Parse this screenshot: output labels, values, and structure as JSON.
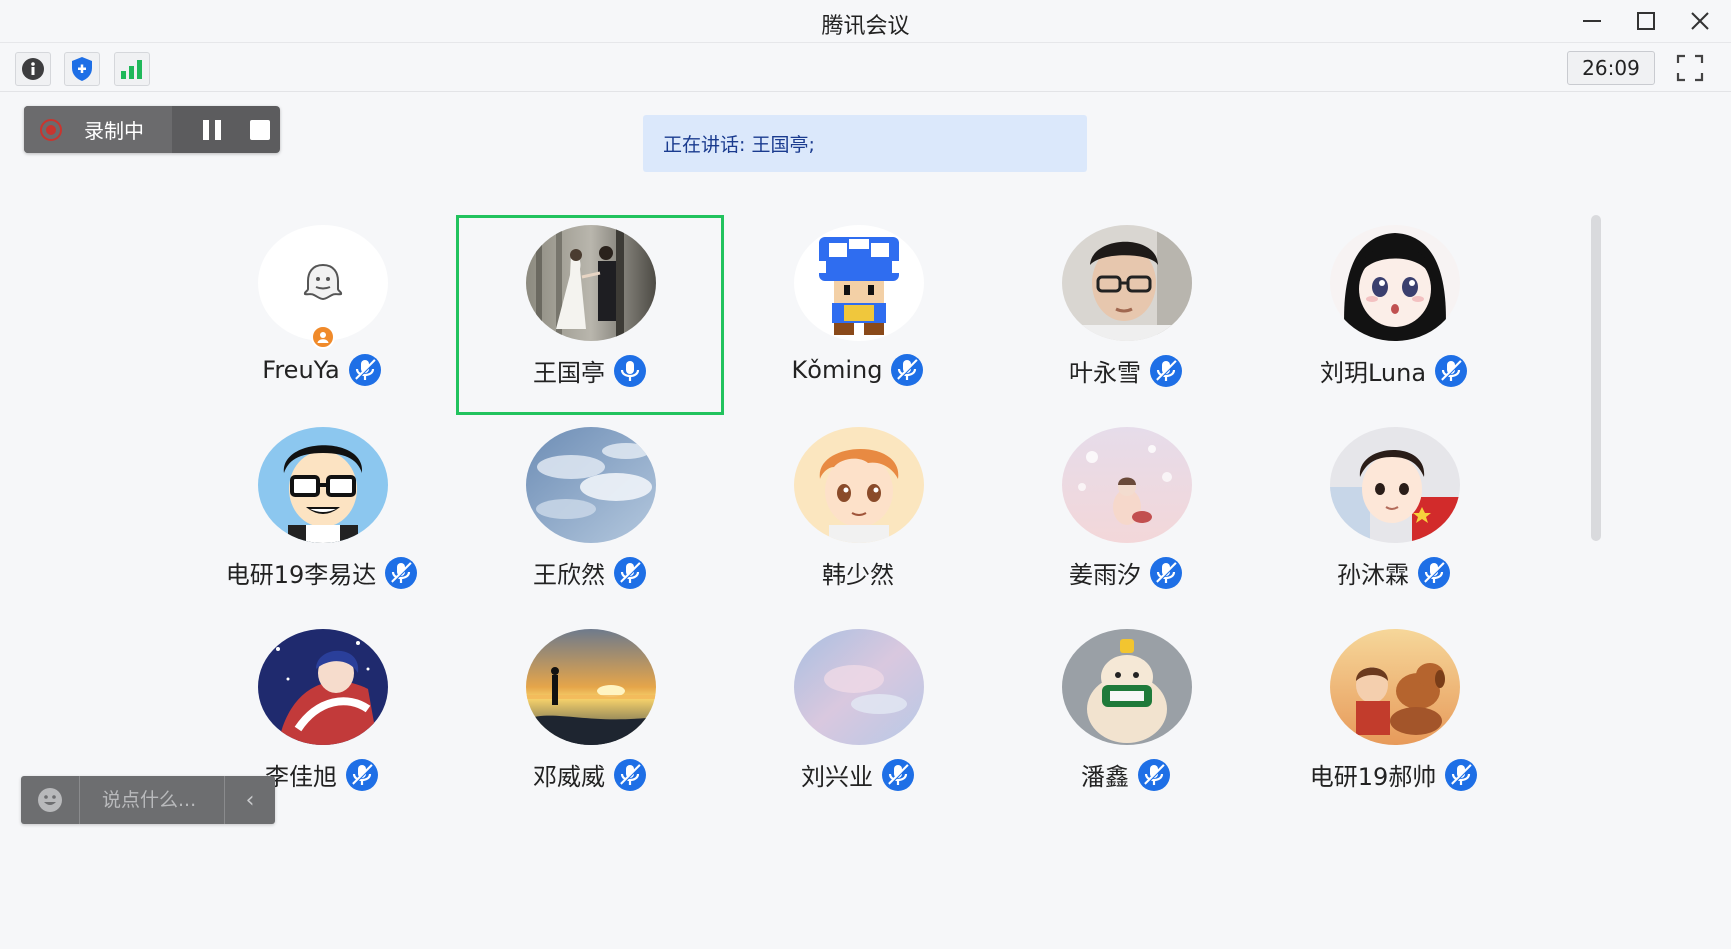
{
  "window": {
    "title": "腾讯会议"
  },
  "toolbar": {
    "timer": "26:09"
  },
  "recording": {
    "label": "录制中"
  },
  "speaking": {
    "text": "正在讲话: 王国亭;"
  },
  "chat": {
    "placeholder": "说点什么..."
  },
  "colors": {
    "active_border": "#22c35e",
    "mic_blue": "#1e6fe6",
    "banner_bg": "#dbe8fb"
  },
  "participants": [
    {
      "name": "FreuYa",
      "mic": "muted",
      "avatar": "ghost-placeholder",
      "host": true
    },
    {
      "name": "王国亭",
      "mic": "on",
      "avatar": "wedding-photo",
      "speaking": true
    },
    {
      "name": "Kǒming",
      "mic": "muted",
      "avatar": "pixel-mushroom"
    },
    {
      "name": "叶永雪",
      "mic": "muted",
      "avatar": "photo-young-man-glasses"
    },
    {
      "name": "刘玥Luna",
      "mic": "muted",
      "avatar": "anime-girl"
    },
    {
      "name": "电研19李易达",
      "mic": "muted",
      "avatar": "cartoon-glasses-boy"
    },
    {
      "name": "王欣然",
      "mic": "muted",
      "avatar": "cloudy-sky"
    },
    {
      "name": "韩少然",
      "mic": "none",
      "avatar": "anime-boy-orange-hair"
    },
    {
      "name": "姜雨汐",
      "mic": "muted",
      "avatar": "pastel-illustration"
    },
    {
      "name": "孙沐霖",
      "mic": "muted",
      "avatar": "anime-boy-flag"
    },
    {
      "name": "李佳旭",
      "mic": "muted",
      "avatar": "anime-night-sky"
    },
    {
      "name": "邓威威",
      "mic": "muted",
      "avatar": "sunset-sea"
    },
    {
      "name": "刘兴业",
      "mic": "muted",
      "avatar": "pastel-sky"
    },
    {
      "name": "潘鑫",
      "mic": "muted",
      "avatar": "dog-bottle"
    },
    {
      "name": "电研19郝帅",
      "mic": "muted",
      "avatar": "boy-with-dog"
    }
  ]
}
